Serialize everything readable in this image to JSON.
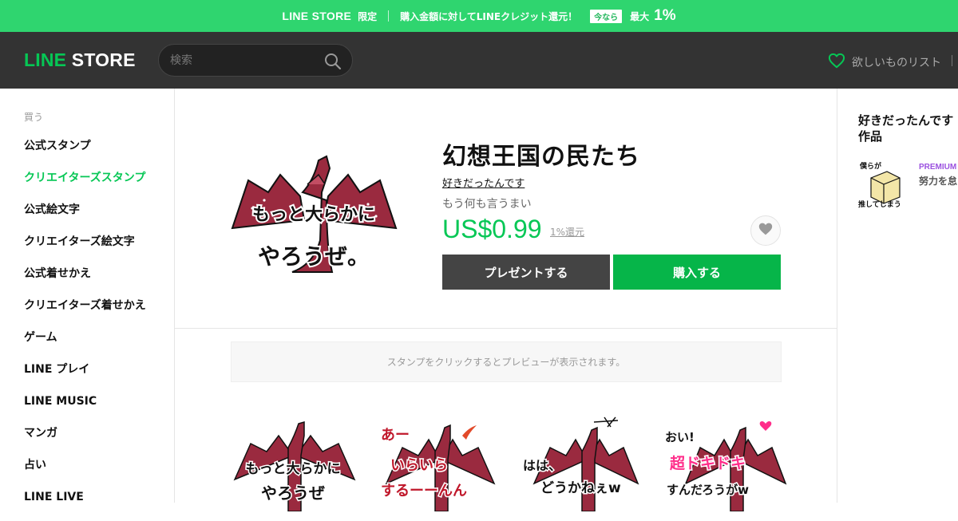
{
  "promo": {
    "brand": "LINE STORE",
    "limited": "限定",
    "message": "購入金額に対してLINEクレジット還元！",
    "badge": "今なら",
    "max": "最大",
    "percent": "1%"
  },
  "header": {
    "logo_line": "LINE",
    "logo_store": "STORE",
    "search_placeholder": "検索",
    "wishlist_label": "欲しいものリスト"
  },
  "sidebar": {
    "section_title": "買う",
    "items": [
      {
        "label": "公式スタンプ",
        "active": false
      },
      {
        "label": "クリエイターズスタンプ",
        "active": true
      },
      {
        "label": "公式絵文字",
        "active": false
      },
      {
        "label": "クリエイターズ絵文字",
        "active": false
      },
      {
        "label": "公式着せかえ",
        "active": false
      },
      {
        "label": "クリエイターズ着せかえ",
        "active": false
      },
      {
        "label": "ゲーム",
        "active": false
      },
      {
        "label": "LINE プレイ",
        "active": false
      },
      {
        "label": "LINE MUSIC",
        "active": false
      },
      {
        "label": "マンガ",
        "active": false
      },
      {
        "label": "占い",
        "active": false
      },
      {
        "label": "LINE LIVE",
        "active": false
      }
    ]
  },
  "product": {
    "title": "幻想王国の民たち",
    "author": "好きだったんです",
    "description": "もう何も言うまい",
    "price": "US$0.99",
    "cashback": "1%還元",
    "gift_button": "プレゼントする",
    "buy_button": "購入する",
    "main_sticker_text_1": "もっと大らかに",
    "main_sticker_text_2": "やろうぜ。"
  },
  "preview": {
    "notice": "スタンプをクリックするとプレビューが表示されます。"
  },
  "stickers": [
    {
      "line1": "もっと大らかに",
      "line2": "やろうぜ"
    },
    {
      "line1": "あー",
      "line2": "いらいら",
      "line3": "するーーんん"
    },
    {
      "line1": "はは、",
      "line2": "どうかねぇw"
    },
    {
      "line1": "おい!",
      "line2": "超ドキドキ",
      "line3": "すんだろうがw"
    }
  ],
  "related": {
    "title": "好きだったんです の作品",
    "badge": "PREMIUM",
    "name": "努力を怠る 族館の仲",
    "thumb_text_1": "僕らが",
    "thumb_text_2": "推してしまう"
  },
  "colors": {
    "accent": "#06c755",
    "promo_bg": "#2fd56f",
    "header_bg": "#333333",
    "dragon": "#9a2a3f"
  }
}
